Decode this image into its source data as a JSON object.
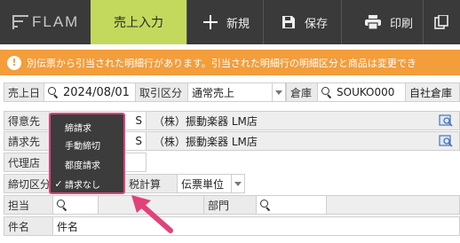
{
  "app": {
    "logo_text": "FLAM"
  },
  "toolbar": {
    "active_tab": "売上入力",
    "new_label": "新規",
    "save_label": "保存",
    "print_label": "印刷"
  },
  "banner": {
    "message": "別伝票から引当された明細行があります。引当された明細行の明細区分と商品は変更でき"
  },
  "form": {
    "row1": {
      "sales_date_label": "売上日",
      "sales_date_value": "2024/08/01",
      "trade_type_label": "取引区分",
      "trade_type_value": "通常売上",
      "warehouse_label": "倉庫",
      "warehouse_value": "SOUKO000",
      "warehouse_name": "自社倉庫"
    },
    "customer_label": "得意先",
    "customer_code_tail": "S",
    "customer_name": "（株）振動楽器 LM店",
    "billing_label": "請求先",
    "billing_code_tail": "S",
    "billing_name": "（株）振動楽器 LM店",
    "agent_label": "代理店",
    "closing_label": "締切区分",
    "tax_label": "税計算",
    "tax_value": "伝票単位",
    "staff_label": "担当",
    "department_label": "部門",
    "subject_label": "件名",
    "subject_value": "件名"
  },
  "closing_menu": {
    "items": [
      {
        "label": "締請求",
        "checked": false
      },
      {
        "label": "手動締切",
        "checked": false
      },
      {
        "label": "都度請求",
        "checked": false
      },
      {
        "label": "請求なし",
        "checked": true
      }
    ],
    "check_glyph": "✓"
  },
  "colors": {
    "accent": "#c3d95e",
    "banner": "#f39d3b",
    "highlight": "#e3417a",
    "topbar": "#3a3a3a"
  }
}
